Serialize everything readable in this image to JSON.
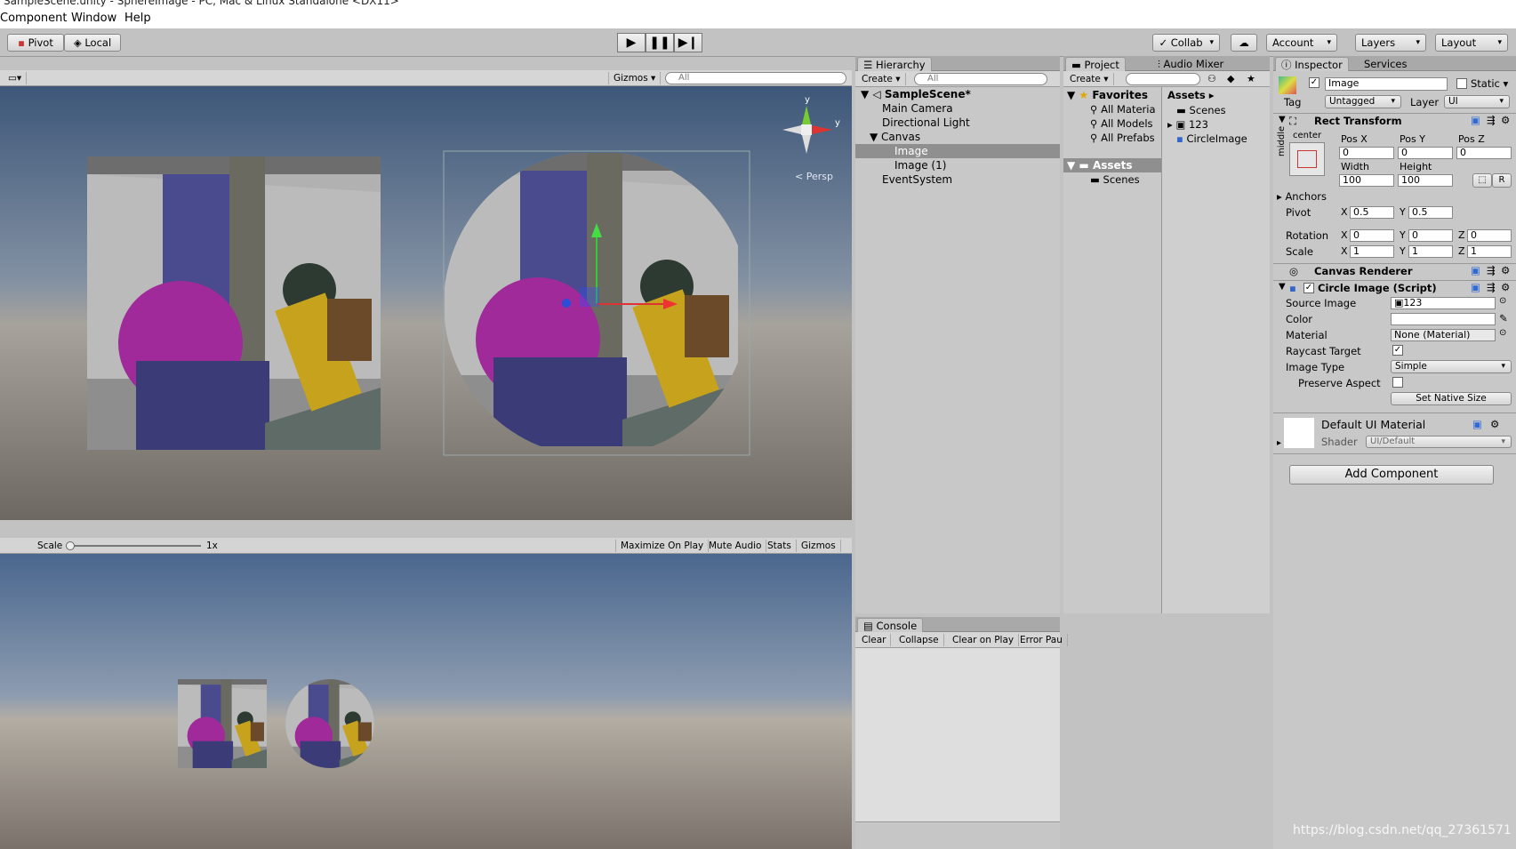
{
  "window": {
    "title": "SampleScene.unity - SphereImage - PC, Mac & Linux Standalone <DX11>"
  },
  "menu": {
    "items": [
      "Component",
      "Window",
      "Help"
    ]
  },
  "toolbar": {
    "pivot": "Pivot",
    "local": "Local",
    "collab": "Collab",
    "account": "Account",
    "layers": "Layers",
    "layout": "Layout"
  },
  "scene_view": {
    "gizmos": "Gizmos",
    "search_placeholder": "All",
    "persp": "Persp",
    "axis_y": "y"
  },
  "game_view": {
    "scale_label": "Scale",
    "scale_value": "1x",
    "buttons": [
      "Maximize On Play",
      "Mute Audio",
      "Stats",
      "Gizmos"
    ]
  },
  "hierarchy": {
    "tab": "Hierarchy",
    "create": "Create",
    "search_placeholder": "All",
    "scene": "SampleScene*",
    "items": [
      "Main Camera",
      "Directional Light",
      "Canvas",
      "Image",
      "Image (1)",
      "EventSystem"
    ]
  },
  "project": {
    "tabs": [
      "Project",
      "Audio Mixer"
    ],
    "create": "Create",
    "favorites_label": "Favorites",
    "favorites": [
      "All Materia",
      "All Models",
      "All Prefabs"
    ],
    "assets_label": "Assets",
    "assets_children": [
      "Scenes"
    ],
    "assets_header": "Assets",
    "asset_items": [
      "Scenes",
      "123",
      "CircleImage"
    ]
  },
  "console": {
    "tab": "Console",
    "buttons": [
      "Clear",
      "Collapse",
      "Clear on Play",
      "Error Pau"
    ]
  },
  "inspector": {
    "tabs": [
      "Inspector",
      "Services"
    ],
    "object_name": "Image",
    "static_label": "Static",
    "tag_label": "Tag",
    "tag_value": "Untagged",
    "layer_label": "Layer",
    "layer_value": "UI",
    "rect_transform": {
      "title": "Rect Transform",
      "anchor_h": "center",
      "anchor_v": "middle",
      "posx_label": "Pos X",
      "posy_label": "Pos Y",
      "posz_label": "Pos Z",
      "posx": "0",
      "posy": "0",
      "posz": "0",
      "width_label": "Width",
      "height_label": "Height",
      "width": "100",
      "height": "100",
      "r_btn": "R",
      "anchors": "Anchors",
      "pivot_label": "Pivot",
      "pivot_x": "0.5",
      "pivot_y": "0.5",
      "rotation_label": "Rotation",
      "rot_x": "0",
      "rot_y": "0",
      "rot_z": "0",
      "scale_label": "Scale",
      "scale_x": "1",
      "scale_y": "1",
      "scale_z": "1",
      "x": "X",
      "y": "Y",
      "z": "Z"
    },
    "canvas_renderer": "Canvas Renderer",
    "circle_image": {
      "title": "Circle Image (Script)",
      "source_image_label": "Source Image",
      "source_image": "123",
      "color_label": "Color",
      "material_label": "Material",
      "material": "None (Material)",
      "raycast_label": "Raycast Target",
      "image_type_label": "Image Type",
      "image_type": "Simple",
      "preserve_label": "Preserve Aspect",
      "set_native": "Set Native Size"
    },
    "material": {
      "name": "Default UI Material",
      "shader_label": "Shader",
      "shader": "UI/Default"
    },
    "add_component": "Add Component"
  },
  "watermark": "https://blog.csdn.net/qq_27361571",
  "colors": {
    "selection": "#3e7de6",
    "panel": "#c8c8c8",
    "accent_blue": "#2f6bd6"
  }
}
